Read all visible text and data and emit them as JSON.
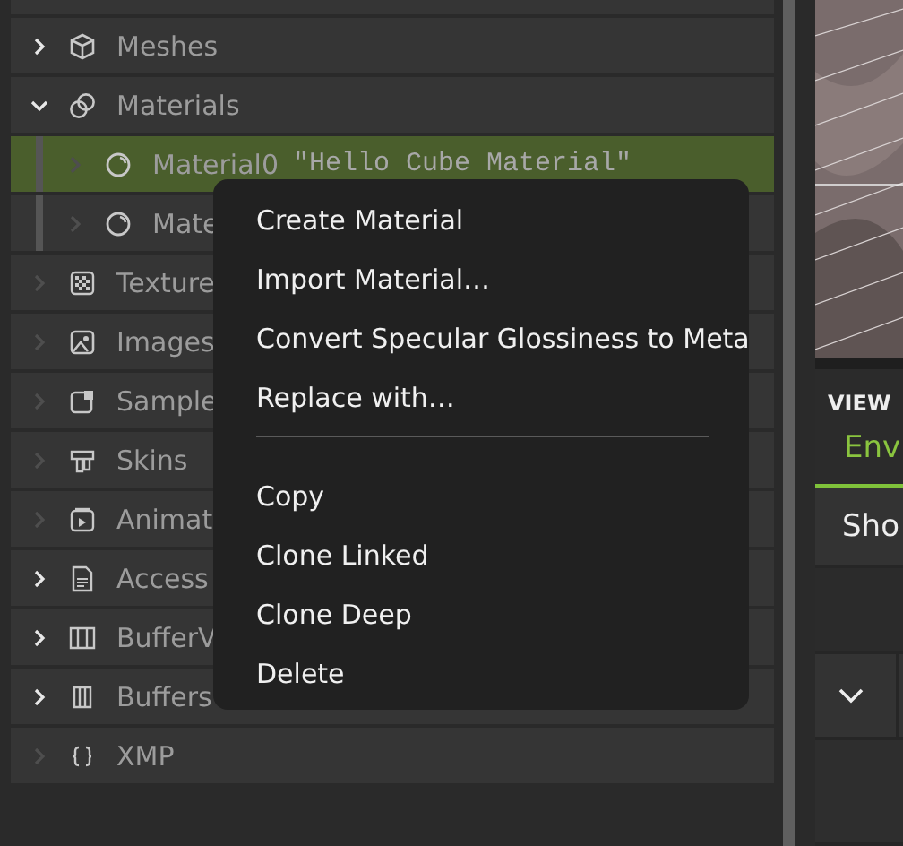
{
  "tree": {
    "items": [
      {
        "label": "Meshes",
        "kind": "meshes",
        "has_children": true,
        "expanded": false,
        "selected": false
      },
      {
        "label": "Materials",
        "kind": "materials",
        "has_children": true,
        "expanded": true,
        "selected": false,
        "children": [
          {
            "label": "Material0",
            "detail": "\"Hello Cube Material\"",
            "kind": "material",
            "has_children": false,
            "expanded": false,
            "selected": true
          },
          {
            "label": "Mate",
            "kind": "material",
            "has_children": false,
            "expanded": false,
            "selected": false
          }
        ]
      },
      {
        "label": "Texture",
        "kind": "textures",
        "has_children": false,
        "expanded": false,
        "selected": false
      },
      {
        "label": "Images",
        "kind": "images",
        "has_children": false,
        "expanded": false,
        "selected": false
      },
      {
        "label": "Sample",
        "kind": "samplers",
        "has_children": false,
        "expanded": false,
        "selected": false
      },
      {
        "label": "Skins",
        "kind": "skins",
        "has_children": false,
        "expanded": false,
        "selected": false
      },
      {
        "label": "Animat",
        "kind": "animations",
        "has_children": false,
        "expanded": false,
        "selected": false
      },
      {
        "label": "Access",
        "kind": "accessors",
        "has_children": true,
        "expanded": false,
        "selected": false
      },
      {
        "label": "BufferV",
        "kind": "bufferviews",
        "has_children": true,
        "expanded": false,
        "selected": false
      },
      {
        "label": "Buffers",
        "kind": "buffers",
        "has_children": true,
        "expanded": false,
        "selected": false
      },
      {
        "label": "XMP",
        "kind": "xmp",
        "has_children": false,
        "expanded": false,
        "selected": false
      }
    ]
  },
  "context_menu": {
    "groups": [
      [
        "Create Material",
        "Import Material…",
        "Convert Specular Glossiness to Meta",
        "Replace with…"
      ],
      [
        "Copy",
        "Clone Linked",
        "Clone Deep",
        "Delete"
      ]
    ]
  },
  "side_panel": {
    "header": "VIEW",
    "tabs": [
      {
        "label": "Env",
        "selected": true
      }
    ],
    "rows": [
      {
        "label": "Sho"
      }
    ],
    "expander": {
      "expanded": true
    }
  }
}
